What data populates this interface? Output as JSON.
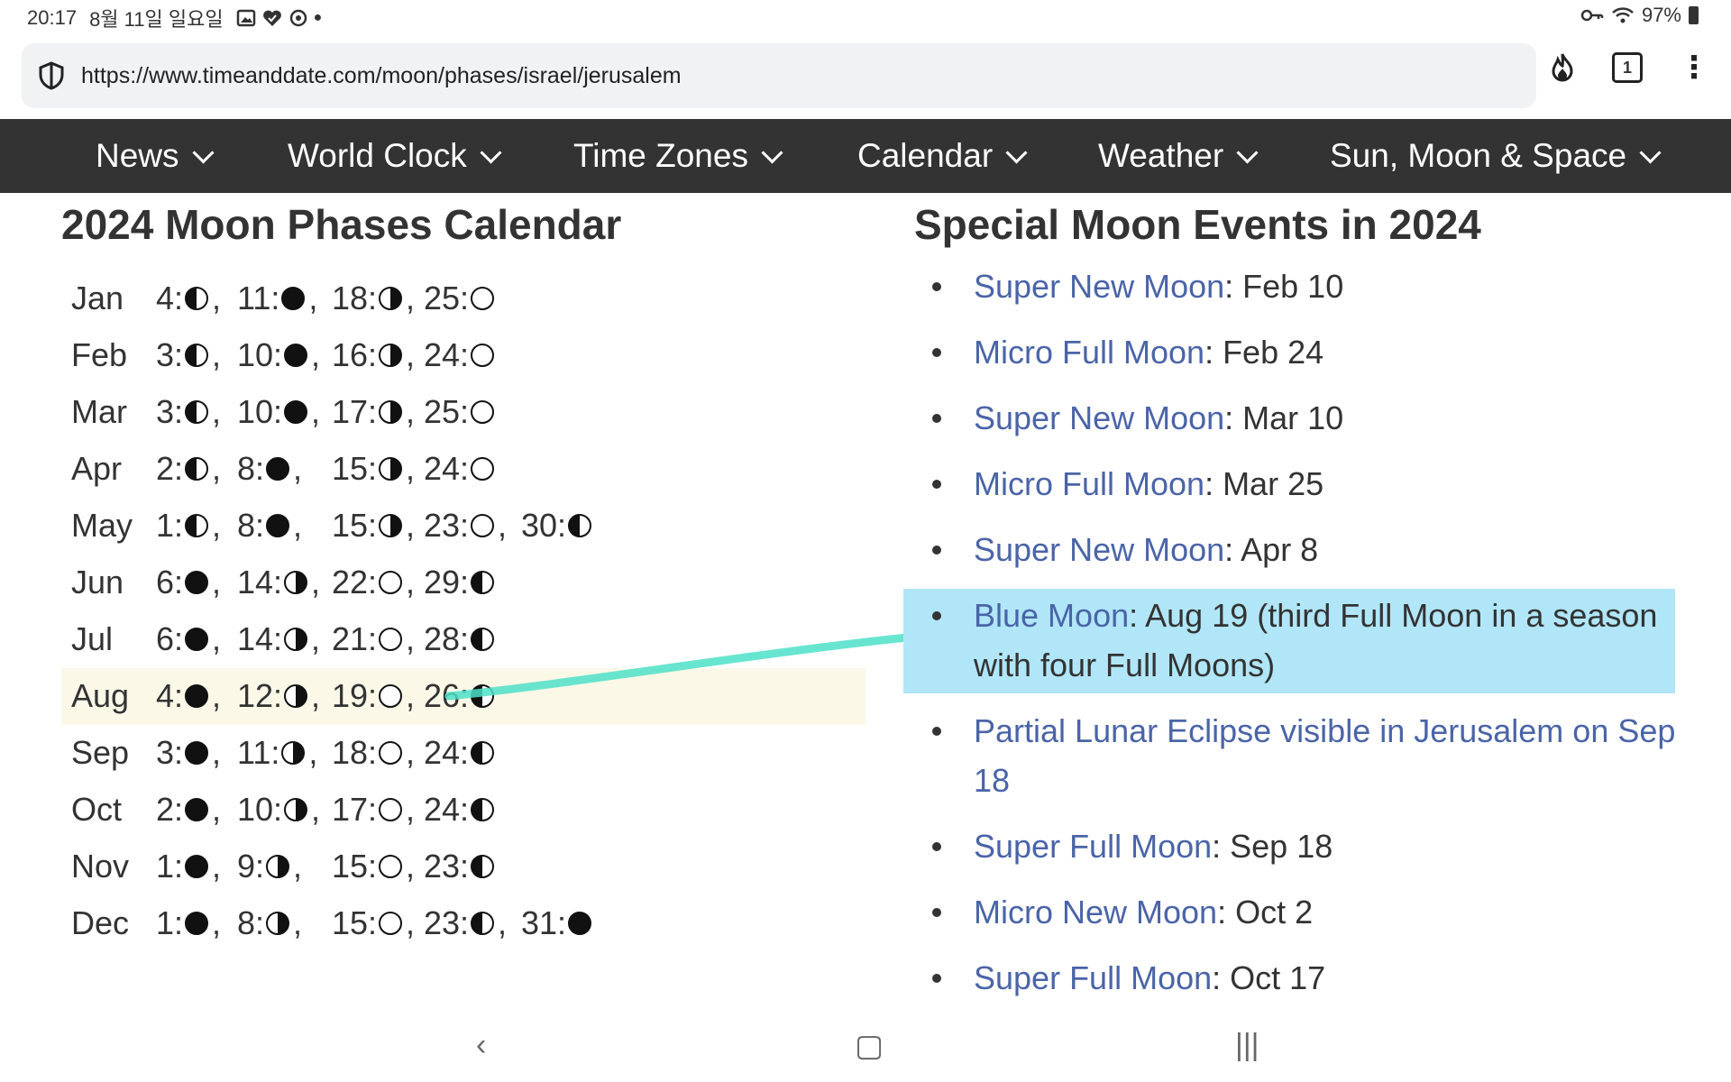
{
  "status_bar": {
    "time": "20:17",
    "date": "8월 11일 일요일",
    "battery": "97%"
  },
  "browser": {
    "url": "https://www.timeanddate.com/moon/phases/israel/jerusalem",
    "tab_count": "1",
    "icons": [
      "shield-icon",
      "flame-icon",
      "tab-switcher-icon",
      "menu-kebab-icon"
    ]
  },
  "nav": {
    "items": [
      {
        "label": "News"
      },
      {
        "label": "World Clock"
      },
      {
        "label": "Time Zones"
      },
      {
        "label": "Calendar"
      },
      {
        "label": "Weather"
      },
      {
        "label": "Sun, Moon & Space"
      }
    ]
  },
  "calendar": {
    "title": "2024 Moon Phases Calendar",
    "highlighted_month": "Aug",
    "rows": [
      {
        "month": "Jan",
        "phases": [
          {
            "d": "4:",
            "p": "third",
            "s": ","
          },
          {
            "d": "11:",
            "p": "new",
            "s": ","
          },
          {
            "d": "18:",
            "p": "first",
            "s": ","
          },
          {
            "d": "25:",
            "p": "full",
            "s": ""
          }
        ]
      },
      {
        "month": "Feb",
        "phases": [
          {
            "d": "3:",
            "p": "third",
            "s": ","
          },
          {
            "d": "10:",
            "p": "new",
            "s": ","
          },
          {
            "d": "16:",
            "p": "first",
            "s": ","
          },
          {
            "d": "24:",
            "p": "full",
            "s": ""
          }
        ]
      },
      {
        "month": "Mar",
        "phases": [
          {
            "d": "3:",
            "p": "third",
            "s": ","
          },
          {
            "d": "10:",
            "p": "new",
            "s": ","
          },
          {
            "d": "17:",
            "p": "first",
            "s": ","
          },
          {
            "d": "25:",
            "p": "full",
            "s": ""
          }
        ]
      },
      {
        "month": "Apr",
        "phases": [
          {
            "d": "2:",
            "p": "third",
            "s": ","
          },
          {
            "d": "8:",
            "p": "new",
            "s": ","
          },
          {
            "d": "15:",
            "p": "first",
            "s": ","
          },
          {
            "d": "24:",
            "p": "full",
            "s": ""
          }
        ]
      },
      {
        "month": "May",
        "phases": [
          {
            "d": "1:",
            "p": "third",
            "s": ","
          },
          {
            "d": "8:",
            "p": "new",
            "s": ","
          },
          {
            "d": "15:",
            "p": "first",
            "s": ","
          },
          {
            "d": "23:",
            "p": "full",
            "s": ","
          },
          {
            "d": "30:",
            "p": "third",
            "s": ""
          }
        ]
      },
      {
        "month": "Jun",
        "phases": [
          {
            "d": "6:",
            "p": "new",
            "s": ","
          },
          {
            "d": "14:",
            "p": "first",
            "s": ","
          },
          {
            "d": "22:",
            "p": "full",
            "s": ","
          },
          {
            "d": "29:",
            "p": "third",
            "s": ""
          }
        ]
      },
      {
        "month": "Jul",
        "phases": [
          {
            "d": "6:",
            "p": "new",
            "s": ","
          },
          {
            "d": "14:",
            "p": "first",
            "s": ","
          },
          {
            "d": "21:",
            "p": "full",
            "s": ","
          },
          {
            "d": "28:",
            "p": "third",
            "s": ""
          }
        ]
      },
      {
        "month": "Aug",
        "phases": [
          {
            "d": "4:",
            "p": "new",
            "s": ","
          },
          {
            "d": "12:",
            "p": "first",
            "s": ","
          },
          {
            "d": "19:",
            "p": "full",
            "s": ","
          },
          {
            "d": "26:",
            "p": "third",
            "s": ""
          }
        ]
      },
      {
        "month": "Sep",
        "phases": [
          {
            "d": "3:",
            "p": "new",
            "s": ","
          },
          {
            "d": "11:",
            "p": "first",
            "s": ","
          },
          {
            "d": "18:",
            "p": "full",
            "s": ","
          },
          {
            "d": "24:",
            "p": "third",
            "s": ""
          }
        ]
      },
      {
        "month": "Oct",
        "phases": [
          {
            "d": "2:",
            "p": "new",
            "s": ","
          },
          {
            "d": "10:",
            "p": "first",
            "s": ","
          },
          {
            "d": "17:",
            "p": "full",
            "s": ","
          },
          {
            "d": "24:",
            "p": "third",
            "s": ""
          }
        ]
      },
      {
        "month": "Nov",
        "phases": [
          {
            "d": "1:",
            "p": "new",
            "s": ","
          },
          {
            "d": "9:",
            "p": "first",
            "s": ","
          },
          {
            "d": "15:",
            "p": "full",
            "s": ","
          },
          {
            "d": "23:",
            "p": "third",
            "s": ""
          }
        ]
      },
      {
        "month": "Dec",
        "phases": [
          {
            "d": "1:",
            "p": "new",
            "s": ","
          },
          {
            "d": "8:",
            "p": "first",
            "s": ","
          },
          {
            "d": "15:",
            "p": "full",
            "s": ","
          },
          {
            "d": "23:",
            "p": "third",
            "s": ","
          },
          {
            "d": "31:",
            "p": "new",
            "s": ""
          }
        ]
      }
    ]
  },
  "events": {
    "title": "Special Moon Events in 2024",
    "items": [
      {
        "link": "Super New Moon",
        "text": ": Feb 10"
      },
      {
        "link": "Micro Full Moon",
        "text": ": Feb 24"
      },
      {
        "link": "Super New Moon",
        "text": ": Mar 10"
      },
      {
        "link": "Micro Full Moon",
        "text": ": Mar 25"
      },
      {
        "link": "Super New Moon",
        "text": ": Apr 8"
      },
      {
        "link": "Blue Moon",
        "text": ": Aug 19 (third Full Moon in a season with four Full Moons)",
        "marked": true
      },
      {
        "link": "Partial Lunar Eclipse visible in Jerusalem on Sep 18",
        "text": ""
      },
      {
        "link": "Super Full Moon",
        "text": ": Sep 18"
      },
      {
        "link": "Micro New Moon",
        "text": ": Oct 2"
      },
      {
        "link": "Super Full Moon",
        "text": ": Oct 17"
      }
    ]
  },
  "colors": {
    "nav_bg": "#333333",
    "link": "#4a64a8",
    "highlight_row": "#fcf8e8",
    "marker_box": "#b0e6f8",
    "annotation_stroke": "#4ee0c8"
  }
}
